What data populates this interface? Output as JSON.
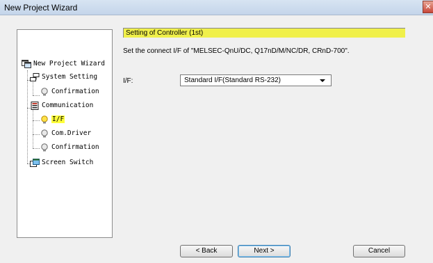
{
  "window": {
    "title": "New Project Wizard",
    "close_glyph": "✕"
  },
  "tree": {
    "items": [
      {
        "label": "New Project Wizard",
        "icon": "project-icon"
      },
      {
        "label": "System Setting",
        "icon": "network-icon"
      },
      {
        "label": "Confirmation",
        "icon": "bulb-icon"
      },
      {
        "label": "Communication",
        "icon": "communication-icon"
      },
      {
        "label": "I/F",
        "icon": "bulb-lit-icon"
      },
      {
        "label": "Com.Driver",
        "icon": "bulb-icon"
      },
      {
        "label": "Confirmation",
        "icon": "bulb-icon"
      },
      {
        "label": "Screen Switch",
        "icon": "screen-icon"
      }
    ],
    "selected_index": 4
  },
  "main": {
    "banner": "Setting of Controller (1st)",
    "description": "Set the connect I/F of \"MELSEC-QnU/DC, Q17nD/M/NC/DR, CRnD-700\".",
    "if_label": "I/F:",
    "if_value": "Standard I/F(Standard RS-232)"
  },
  "buttons": {
    "back": "< Back",
    "next": "Next >",
    "cancel": "Cancel"
  },
  "colors": {
    "banner": "#f0f04a",
    "selection": "#ffff3a"
  }
}
